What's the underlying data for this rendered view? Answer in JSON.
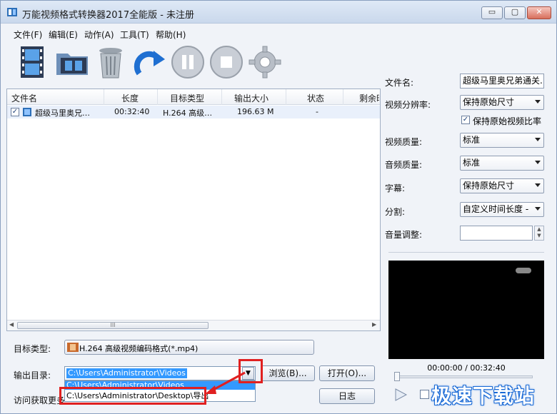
{
  "window": {
    "title": "万能视频格式转换器2017全能版 - 未注册",
    "controls": {
      "minimize": "▭",
      "maximize": "▢",
      "close": "✕"
    }
  },
  "menu": {
    "items": [
      "文件(F)",
      "编辑(E)",
      "动作(A)",
      "工具(T)",
      "帮助(H)"
    ]
  },
  "toolbar": {
    "tools": [
      "film-add-icon",
      "folder-film-icon",
      "trash-icon",
      "redo-arrow-icon",
      "pause-icon",
      "stop-icon",
      "gear-icon"
    ]
  },
  "file_list": {
    "columns": [
      "文件名",
      "长度",
      "目标类型",
      "输出大小",
      "状态",
      "剩余时"
    ],
    "rows": [
      {
        "checked": true,
        "name": "超级马里奥兄…",
        "length": "00:32:40",
        "target": "H.264 高级…",
        "size": "196.63 M",
        "status": "-"
      }
    ],
    "scroll_thumb": "III",
    "scroll_left": "◀",
    "scroll_right": "▶"
  },
  "bottom": {
    "target_label": "目标类型:",
    "target_value": "H.264 高级视频编码格式(*.mp4)",
    "output_label": "输出目录:",
    "output_value": "C:\\Users\\Administrator\\Videos",
    "output_options": [
      "C:\\Users\\Administrator\\Videos",
      "C:\\Users\\Administrator\\Desktop\\导出"
    ],
    "browse_label": "浏览(B)...",
    "open_label": "打开(O)...",
    "visit_label": "访问获取更多",
    "log_label": "日志"
  },
  "settings": {
    "filename_label": "文件名:",
    "filename_value": "超级马里奥兄弟通关.",
    "resolution_label": "视频分辨率:",
    "resolution_value": "保持原始尺寸",
    "keep_ratio_label": "保持原始视频比率",
    "keep_ratio_checked": true,
    "video_quality_label": "视频质量:",
    "video_quality_value": "标准",
    "audio_quality_label": "音频质量:",
    "audio_quality_value": "标准",
    "subtitle_label": "字幕:",
    "subtitle_value": "保持原始尺寸",
    "split_label": "分割:",
    "split_value": "自定义时间长度 -",
    "volume_label": "音量调整:",
    "volume_value": ""
  },
  "preview": {
    "time": "00:00:00 / 00:32:40",
    "seek_fraction": 0
  },
  "watermark": "极速下载站",
  "colors": {
    "accent": "#3399ff",
    "highlight_red": "#e02020"
  }
}
